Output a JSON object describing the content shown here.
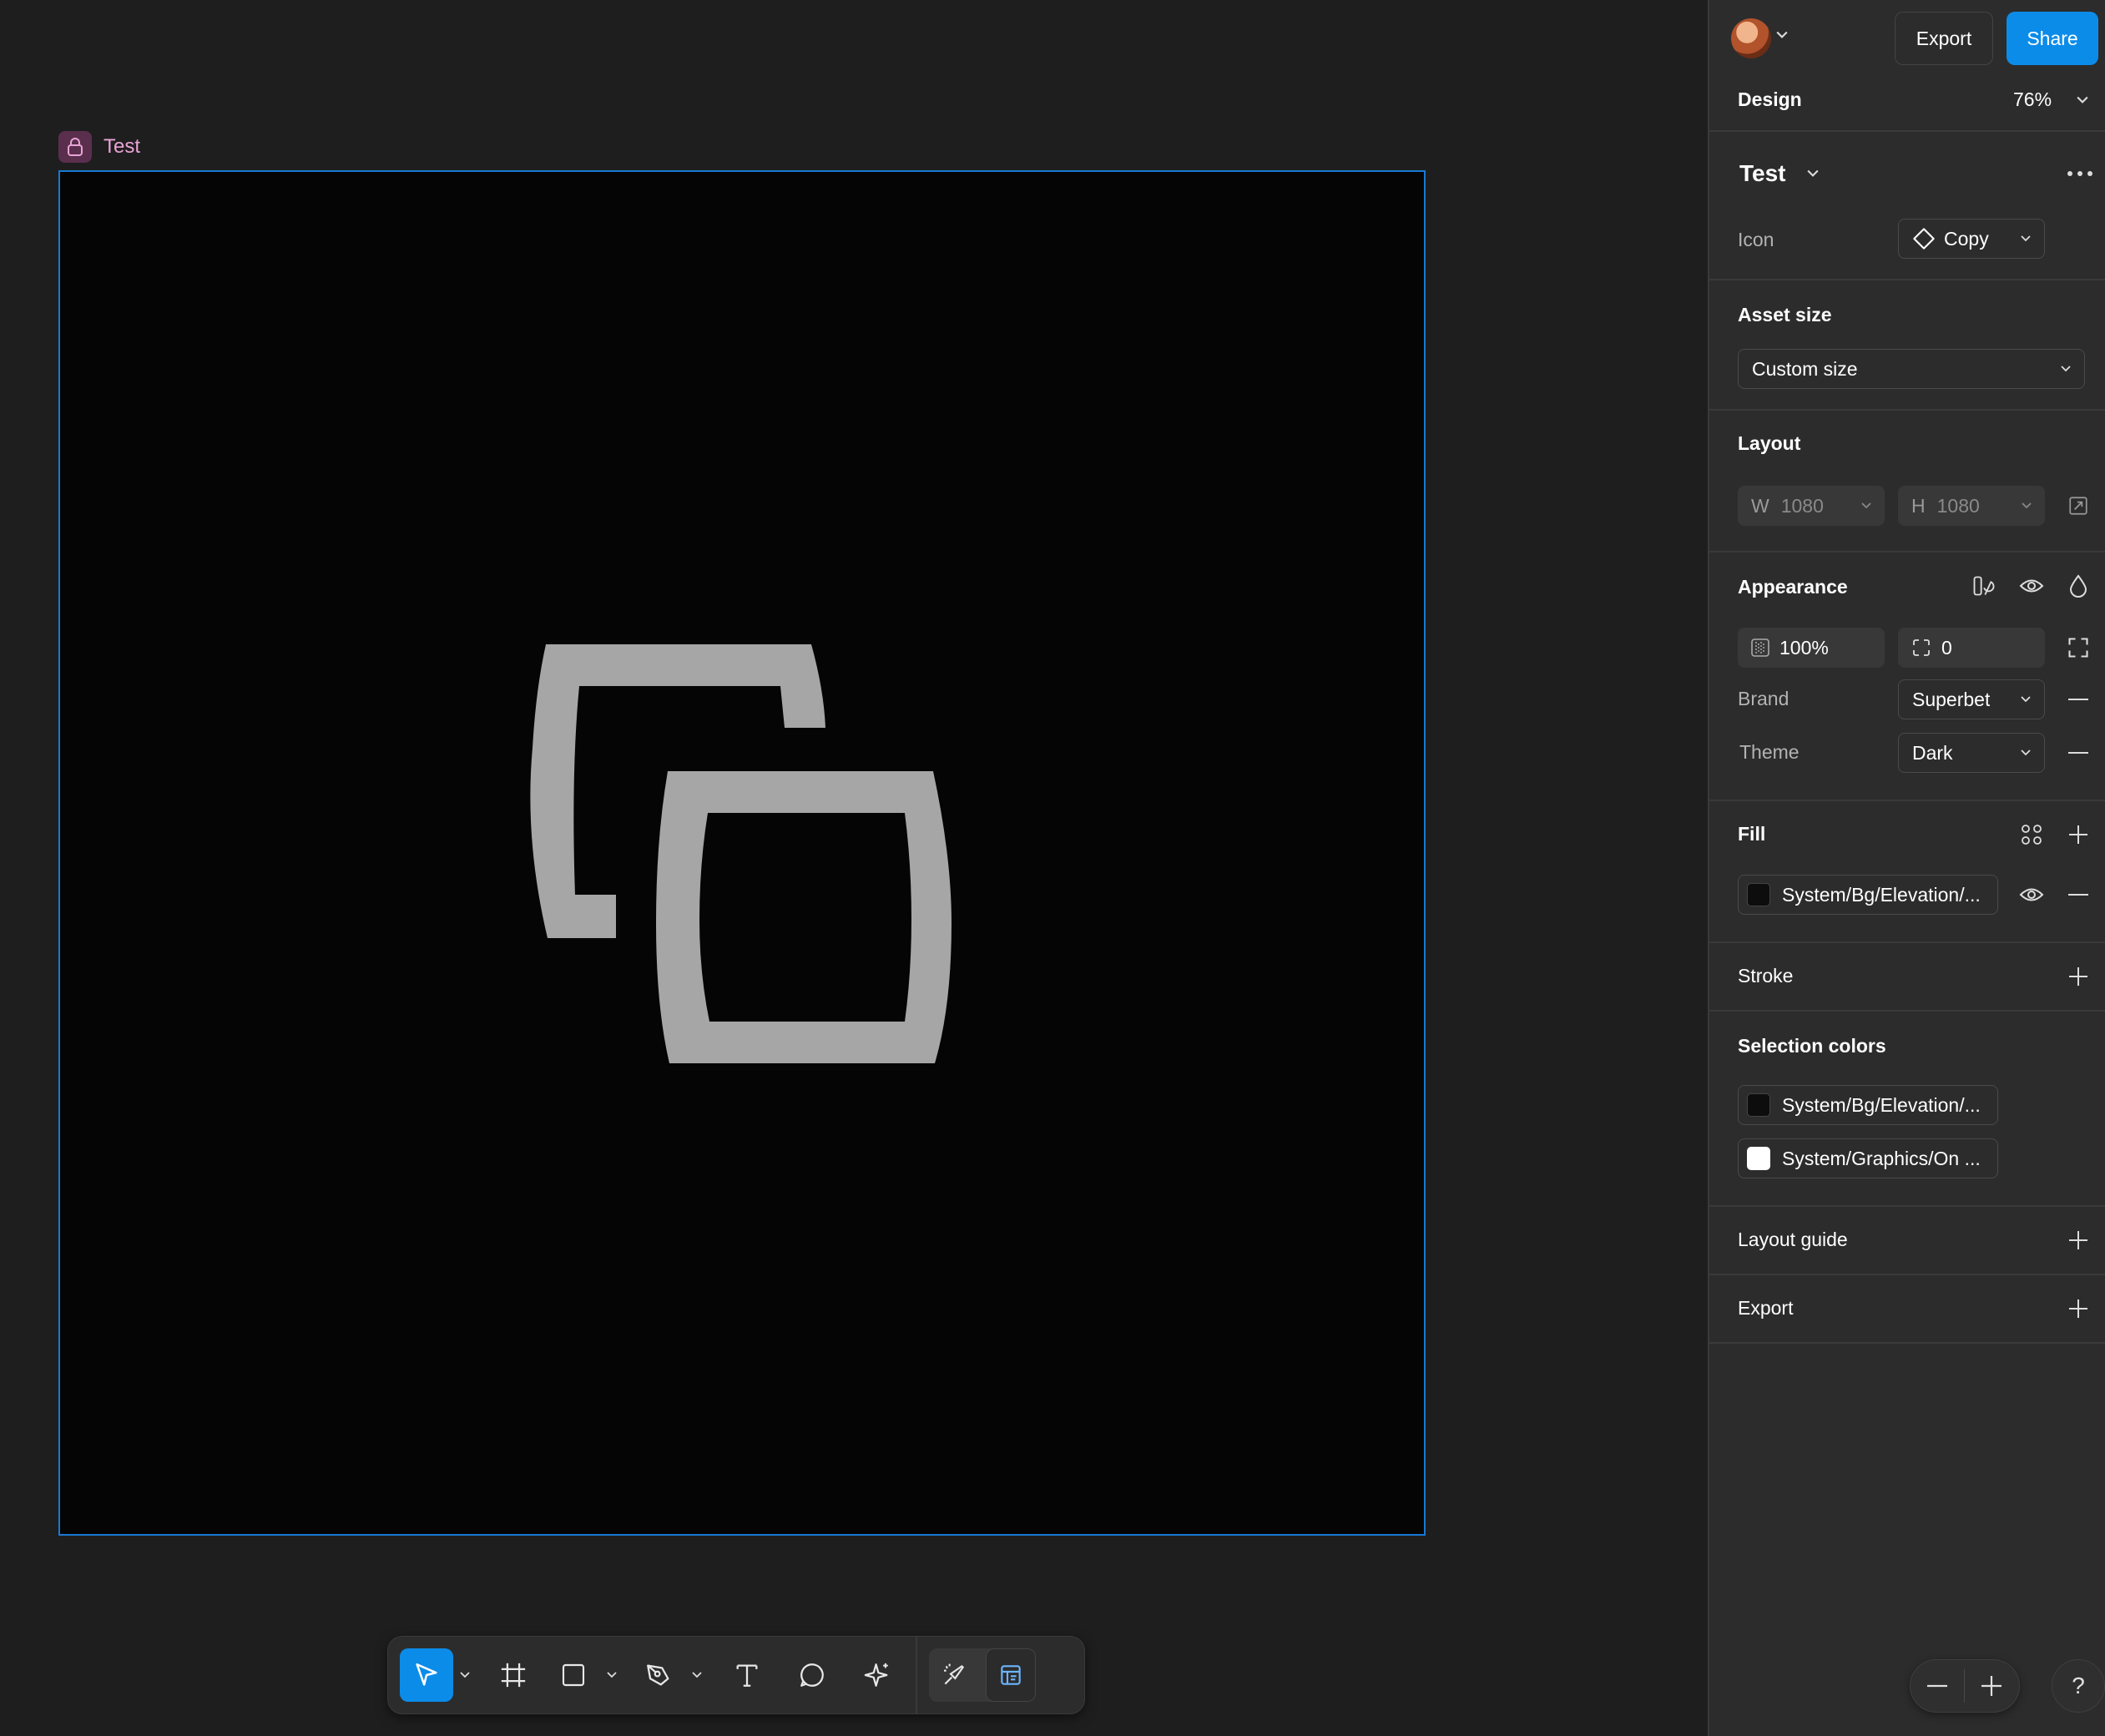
{
  "canvas": {
    "frame_name": "Test"
  },
  "toolbar": {
    "tools": [
      "move-tool",
      "frame-tool",
      "shape-tool",
      "pen-tool",
      "text-tool",
      "comment-tool",
      "actions-tool"
    ],
    "mode_buttons": [
      "draw-mode",
      "dev-mode"
    ]
  },
  "header": {
    "export_label": "Export",
    "share_label": "Share",
    "design_label": "Design",
    "zoom": "76%"
  },
  "component": {
    "name": "Test",
    "icon_label": "Icon",
    "icon_value": "Copy"
  },
  "asset_size": {
    "title": "Asset size",
    "value": "Custom size"
  },
  "layout": {
    "title": "Layout",
    "w_label": "W",
    "w_value": "1080",
    "h_label": "H",
    "h_value": "1080"
  },
  "appearance": {
    "title": "Appearance",
    "opacity": "100%",
    "radius": "0",
    "brand_label": "Brand",
    "brand_value": "Superbet",
    "theme_label": "Theme",
    "theme_value": "Dark"
  },
  "fill": {
    "title": "Fill",
    "value": "System/Bg/Elevation/...",
    "swatch_color": "#0d0d0d"
  },
  "stroke": {
    "title": "Stroke"
  },
  "selection_colors": {
    "title": "Selection colors",
    "items": [
      {
        "label": "System/Bg/Elevation/...",
        "color": "#0d0d0d"
      },
      {
        "label": "System/Graphics/On ...",
        "color": "#ffffff"
      }
    ]
  },
  "layout_guide": {
    "title": "Layout guide"
  },
  "export_section": {
    "title": "Export"
  },
  "help": {
    "label": "?"
  },
  "colors": {
    "accent": "#0c8ce9",
    "canvas_bg": "#1e1e1e",
    "frame_bg": "#050505",
    "icon_gray": "#a6a6a6",
    "panel_bg": "#2c2c2c"
  }
}
